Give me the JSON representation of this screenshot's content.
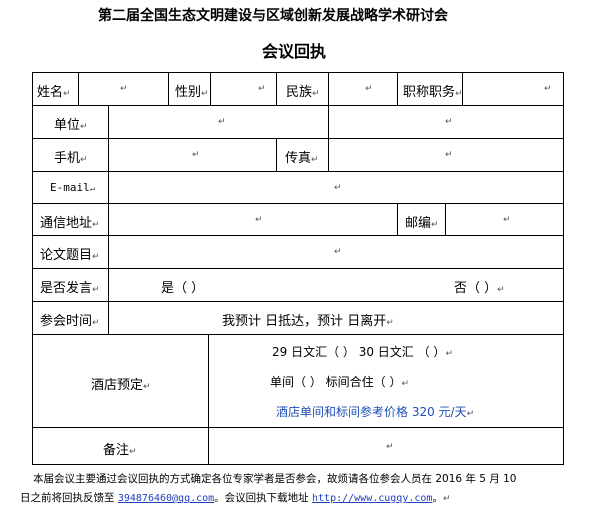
{
  "header": {
    "title": "第二届全国生态文明建设与区域创新发展战略学术研讨会",
    "subtitle": "会议回执"
  },
  "marker": "↵",
  "form": {
    "name_label": "姓名",
    "gender_label": "性别",
    "ethnicity_label": "民族",
    "title_label": "职称职务",
    "unit_label": "单位",
    "mobile_label": "手机",
    "fax_label": "传真",
    "email_label": "E-mail",
    "address_label": "通信地址",
    "postcode_label": "邮编",
    "paper_title_label": "论文题目",
    "speak_label": "是否发言",
    "speak_yes": "是（    ）",
    "speak_no": "否（    ）",
    "time_label": "参会时间",
    "time_text": "我预计      日抵达，预计      日离开",
    "hotel_label": "酒店预定",
    "hotel_line1": "29 日文汇（  ）      30 日文汇  （    ）",
    "hotel_line2": "单间（  ）           标间合住（    ）",
    "hotel_price": "酒店单间和标间参考价格 320 元/天",
    "remark_label": "备注"
  },
  "footer": {
    "text1": "本届会议主要通过会议回执的方式确定各位专家学者是否参会，故烦请各位参会人员在 2016 年 5 月 10",
    "text2_a": "日之前将回执反馈至 ",
    "email": "394876460@qq.com",
    "text2_b": "。会议回执下载地址 ",
    "url": "http://www.cugqy.com",
    "text2_c": "。"
  }
}
